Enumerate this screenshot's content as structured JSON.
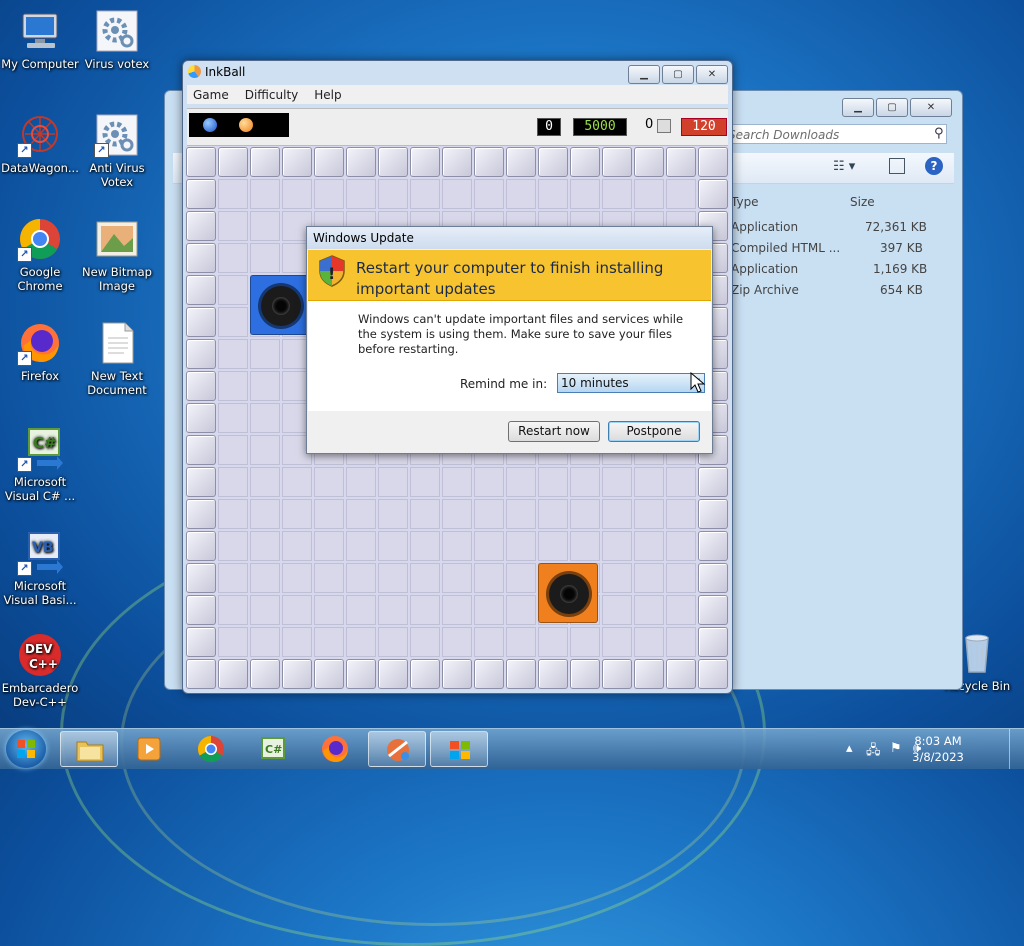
{
  "desktop": {
    "icons": [
      {
        "label": "My Computer",
        "icon": "computer-icon"
      },
      {
        "label": "Virus votex",
        "icon": "gear-settings-icon"
      },
      {
        "label": "DataWagon...",
        "icon": "datawagon-icon"
      },
      {
        "label": "Anti Virus Votex",
        "icon": "gear-settings-icon"
      },
      {
        "label": "Google Chrome",
        "icon": "chrome-icon"
      },
      {
        "label": "New Bitmap Image",
        "icon": "bitmap-icon"
      },
      {
        "label": "Firefox",
        "icon": "firefox-icon"
      },
      {
        "label": "New Text Document",
        "icon": "text-document-icon"
      },
      {
        "label": "Microsoft Visual C# ...",
        "icon": "csharp-icon"
      },
      {
        "label": "Microsoft Visual Basi...",
        "icon": "vb-icon"
      },
      {
        "label": "Embarcadero Dev-C++",
        "icon": "devcpp-icon"
      },
      {
        "label": "Recycle Bin",
        "icon": "recycle-bin-icon"
      }
    ]
  },
  "explorer": {
    "search_placeholder": "Search Downloads",
    "columns": {
      "type": "Type",
      "size": "Size"
    },
    "rows": [
      {
        "type": "Application",
        "size": "72,361 KB"
      },
      {
        "type": "Compiled HTML ...",
        "size": "397 KB"
      },
      {
        "type": "Application",
        "size": "1,169 KB"
      },
      {
        "type": "Zip Archive",
        "size": "654 KB"
      }
    ]
  },
  "inkball": {
    "title": "InkBall",
    "menu": [
      "Game",
      "Difficulty",
      "Help"
    ],
    "score": "0",
    "high_score": "5000",
    "paused_count": "0",
    "time": "120",
    "colors": {
      "blue_hole": "#2d6fe0",
      "orange_hole": "#f07f1e",
      "time_bg": "#d0402a",
      "high_score_fg": "#9be04a"
    }
  },
  "dialog": {
    "title": "Windows Update",
    "heading": "Restart your computer to finish installing important updates",
    "message": "Windows can't update important files and services while the system is using them. Make sure to save your files before restarting.",
    "remind_label": "Remind me in:",
    "remind_value": "10 minutes",
    "restart_label": "Restart now",
    "postpone_label": "Postpone"
  },
  "taskbar": {
    "time": "8:03 AM",
    "date": "3/8/2023",
    "buttons": [
      "start-button",
      "explorer",
      "media-player",
      "chrome",
      "csharp",
      "firefox",
      "inkball",
      "windows-update"
    ]
  }
}
